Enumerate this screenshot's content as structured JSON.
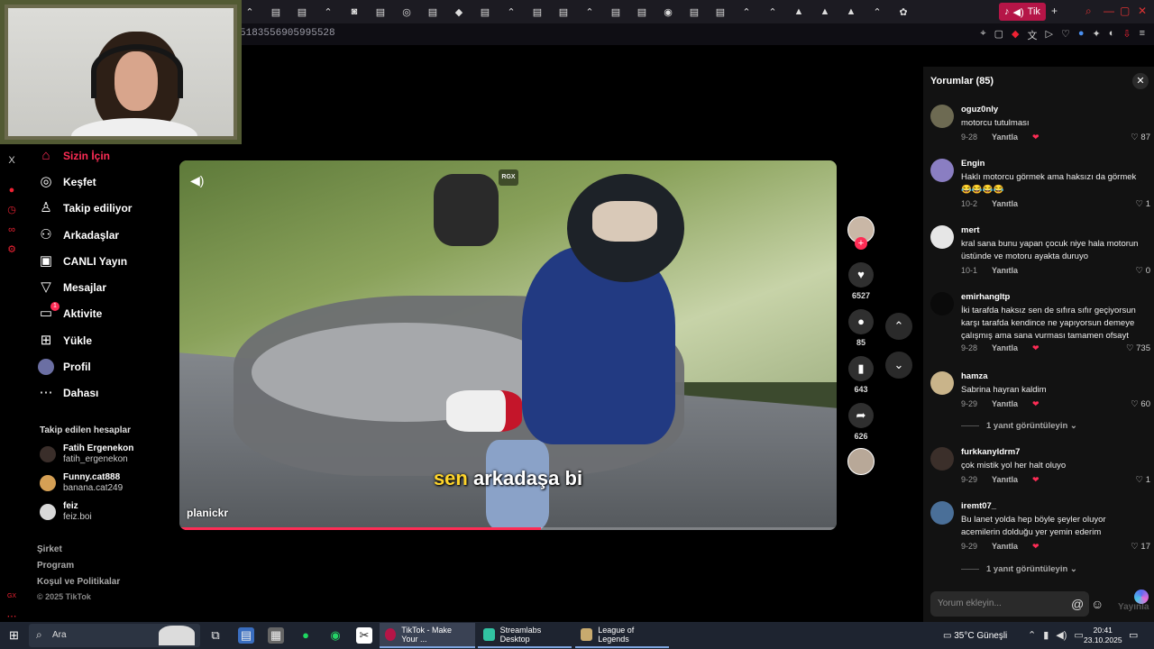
{
  "browser": {
    "active_tab_label": "Tik",
    "url_fragment": "5183556905995528"
  },
  "sidebar": {
    "items": [
      {
        "label": "Sizin İçin",
        "icon": "home-icon",
        "active": true
      },
      {
        "label": "Keşfet",
        "icon": "compass-icon"
      },
      {
        "label": "Takip ediliyor",
        "icon": "following-icon"
      },
      {
        "label": "Arkadaşlar",
        "icon": "friends-icon"
      },
      {
        "label": "CANLI Yayın",
        "icon": "live-icon"
      },
      {
        "label": "Mesajlar",
        "icon": "messages-icon"
      },
      {
        "label": "Aktivite",
        "icon": "activity-icon",
        "badge": "1"
      },
      {
        "label": "Yükle",
        "icon": "upload-icon"
      },
      {
        "label": "Profil",
        "icon": "profile-icon"
      },
      {
        "label": "Dahası",
        "icon": "more-icon"
      }
    ],
    "following_title": "Takip edilen hesaplar",
    "following": [
      {
        "name": "Fatih Ergenekon",
        "user": "fatih_ergenekon"
      },
      {
        "name": "Funny.cat888",
        "user": "banana.cat249"
      },
      {
        "name": "feiz",
        "user": "feiz.boi"
      }
    ],
    "footer": [
      "Şirket",
      "Program",
      "Koşul ve Politikalar"
    ],
    "copyright": "© 2025 TikTok"
  },
  "video": {
    "subtitle_highlight": "sen",
    "subtitle_rest": "arkadaşa bi",
    "creator": "planickr",
    "watermark": "RGX",
    "progress": 0.55
  },
  "actions": {
    "likes": "6527",
    "comments": "85",
    "saves": "643",
    "shares": "626"
  },
  "comments": {
    "title": "Yorumlar (85)",
    "reply_label": "Yanıtla",
    "more_replies": "1 yanıt görüntüleyin",
    "input_placeholder": "Yorum ekleyin...",
    "post_label": "Yayınla",
    "items": [
      {
        "user": "oguz0nly",
        "text": "motorcu tutulması",
        "date": "9-28",
        "likes": "87"
      },
      {
        "user": "Engin",
        "text": "Haklı motorcu görmek ama haksızı da görmek 😂😂😂😂",
        "date": "10-2",
        "likes": "1"
      },
      {
        "user": "mert",
        "text": "kral sana bunu yapan çocuk niye hala motorun üstünde ve motoru ayakta duruyo",
        "date": "10-1",
        "likes": "0"
      },
      {
        "user": "emirhangltp",
        "text": "İki tarafda haksız sen de sıfıra sıfır geçiyorsun karşı tarafda kendince ne yapıyorsun demeye çalışmış ama sana vurması tamamen ofsayt",
        "date": "9-28",
        "likes": "735"
      },
      {
        "user": "hamza",
        "text": "Sabrina hayran kaldim",
        "date": "9-29",
        "likes": "60"
      },
      {
        "user": "furkkanyldrm7",
        "text": "çok mistik yol her halt oluyo",
        "date": "9-29",
        "likes": "1"
      },
      {
        "user": "iremt07_",
        "text": "Bu lanet yolda hep böyle şeyler oluyor acemilerin dolduğu yer yemin ederim",
        "date": "9-29",
        "likes": "17"
      }
    ]
  },
  "taskbar": {
    "search_placeholder": "Ara",
    "apps": [
      {
        "label": "TikTok - Make Your ...",
        "active": true
      },
      {
        "label": "Streamlabs Desktop"
      },
      {
        "label": "League of Legends"
      }
    ],
    "weather": "35°C  Güneşli",
    "time": "20:41",
    "date": "23.10.2025"
  },
  "colors": {
    "accent": "#fe2c55",
    "subtitle_highlight": "#ffd52b"
  }
}
